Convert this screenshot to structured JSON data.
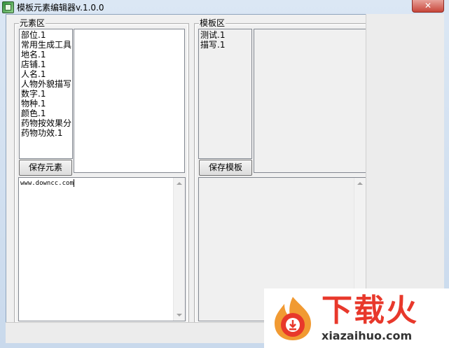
{
  "window": {
    "title": "模板元素编辑器v.1.0.0",
    "close_symbol": "✕"
  },
  "elements_group": {
    "legend": "元素区",
    "items": [
      "部位.1",
      "常用生成工具",
      "地名.1",
      "店铺.1",
      "人名.1",
      "人物外貌描写",
      "数字.1",
      "物种.1",
      "颜色.1",
      "药物按效果分",
      "药物功效.1"
    ],
    "save_label": "保存元素",
    "editor_text": "www.downcc.com"
  },
  "template_group": {
    "legend": "模板区",
    "items": [
      "测试.1",
      "描写.1"
    ],
    "save_label": "保存模板"
  },
  "watermark": {
    "brand": "下载火",
    "url": "xiazaihuo.com"
  }
}
